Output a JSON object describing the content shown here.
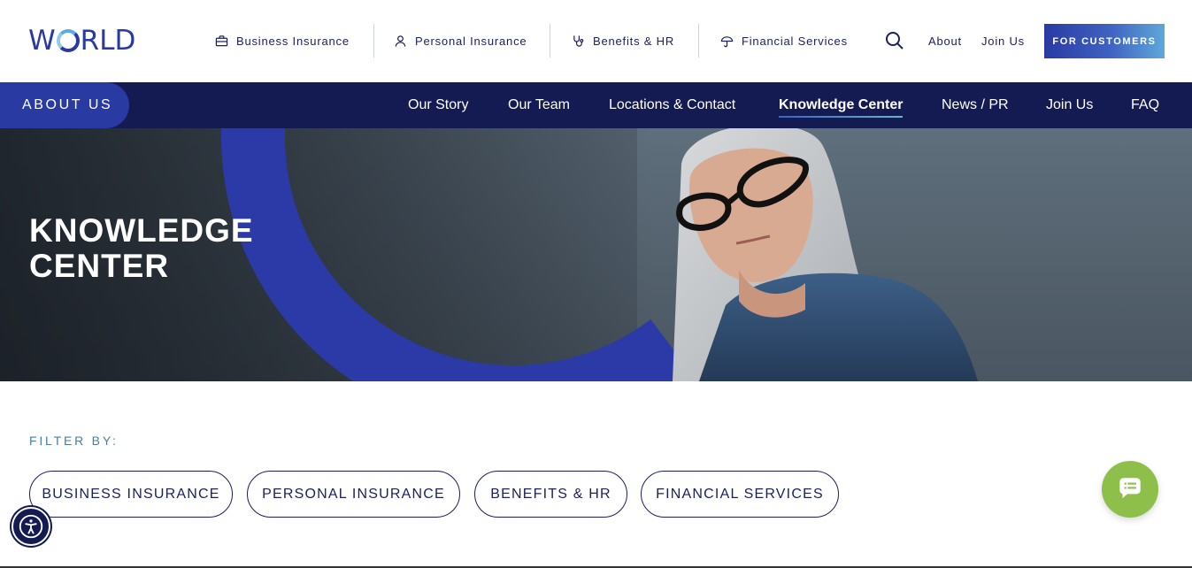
{
  "header": {
    "logo": {
      "prefix": "W",
      "suffix": "RLD"
    },
    "nav": [
      {
        "label": "Business Insurance",
        "icon": "briefcase-icon"
      },
      {
        "label": "Personal Insurance",
        "icon": "person-icon"
      },
      {
        "label": "Benefits & HR",
        "icon": "stethoscope-icon"
      },
      {
        "label": "Financial Services",
        "icon": "umbrella-icon"
      }
    ],
    "search_icon": "search-icon",
    "about_label": "About",
    "join_label": "Join Us",
    "customers_label": "FOR CUSTOMERS"
  },
  "subnav": {
    "section_label": "ABOUT US",
    "links": [
      {
        "label": "Our Story",
        "active": false
      },
      {
        "label": "Our Team",
        "active": false
      },
      {
        "label": "Locations & Contact",
        "active": false
      },
      {
        "label": "Knowledge Center",
        "active": true
      },
      {
        "label": "News / PR",
        "active": false
      },
      {
        "label": "Join Us",
        "active": false
      },
      {
        "label": "FAQ",
        "active": false
      }
    ]
  },
  "hero": {
    "title_line1": "KNOWLEDGE",
    "title_line2": "CENTER"
  },
  "filters": {
    "label": "FILTER BY:",
    "options": [
      "BUSINESS INSURANCE",
      "PERSONAL INSURANCE",
      "BENEFITS & HR",
      "FINANCIAL SERVICES"
    ]
  },
  "widgets": {
    "accessibility_icon": "accessibility-icon",
    "chat_icon": "chat-bubble-icon"
  },
  "colors": {
    "navy": "#141a52",
    "brand_blue": "#2a3aa3",
    "chat_green": "#8dbf4a",
    "filter_label": "#4a7fa0"
  }
}
